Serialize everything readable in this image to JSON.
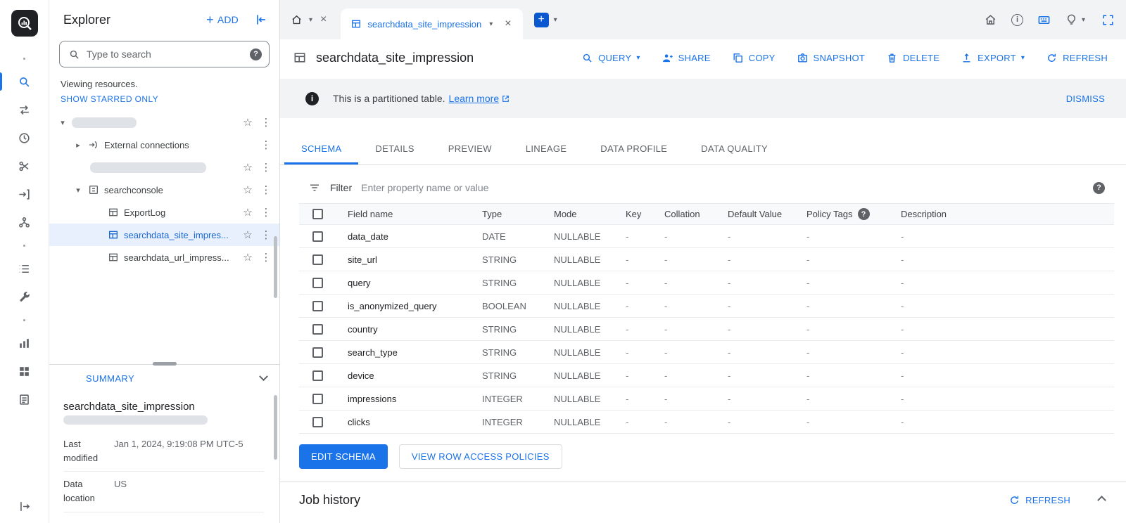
{
  "colors": {
    "accent": "#1a73e8",
    "selected_row_bg": "#e8f0fe",
    "strip_bg": "#f1f3f4"
  },
  "icons": {
    "star": "☆",
    "kebab": "⋮",
    "caret_down": "▾",
    "caret_right": "▸",
    "close": "×",
    "plus": "+",
    "help": "?",
    "info": "i"
  },
  "explorer": {
    "title": "Explorer",
    "add_label": "ADD",
    "search_placeholder": "Type to search",
    "viewing_text": "Viewing resources.",
    "show_starred_label": "SHOW STARRED ONLY",
    "tree": {
      "external_connections": "External connections",
      "dataset_searchconsole": "searchconsole",
      "table_exportlog": "ExportLog",
      "table_site_impression": "searchdata_site_impres...",
      "table_url_impression": "searchdata_url_impress..."
    },
    "summary": {
      "header": "SUMMARY",
      "table_name": "searchdata_site_impression",
      "rows": [
        {
          "label": "Last modified",
          "value": "Jan 1, 2024, 9:19:08 PM UTC-5"
        },
        {
          "label": "Data location",
          "value": "US"
        }
      ]
    }
  },
  "tabstrip": {
    "active_tab_label": "searchdata_site_impression"
  },
  "main": {
    "title": "searchdata_site_impression",
    "actions": {
      "query": "QUERY",
      "share": "SHARE",
      "copy": "COPY",
      "snapshot": "SNAPSHOT",
      "delete": "DELETE",
      "export": "EXPORT",
      "refresh": "REFRESH"
    },
    "banner": {
      "message": "This is a partitioned table.",
      "link_label": "Learn more",
      "dismiss_label": "DISMISS"
    },
    "tabs": [
      "SCHEMA",
      "DETAILS",
      "PREVIEW",
      "LINEAGE",
      "DATA PROFILE",
      "DATA QUALITY"
    ],
    "filter": {
      "label": "Filter",
      "placeholder": "Enter property name or value"
    },
    "schema": {
      "columns": [
        "Field name",
        "Type",
        "Mode",
        "Key",
        "Collation",
        "Default Value",
        "Policy Tags",
        "Description"
      ],
      "rows": [
        {
          "name": "data_date",
          "type": "DATE",
          "mode": "NULLABLE",
          "key": "-",
          "collation": "-",
          "default": "-",
          "policy": "-",
          "description": "-"
        },
        {
          "name": "site_url",
          "type": "STRING",
          "mode": "NULLABLE",
          "key": "-",
          "collation": "-",
          "default": "-",
          "policy": "-",
          "description": "-"
        },
        {
          "name": "query",
          "type": "STRING",
          "mode": "NULLABLE",
          "key": "-",
          "collation": "-",
          "default": "-",
          "policy": "-",
          "description": "-"
        },
        {
          "name": "is_anonymized_query",
          "type": "BOOLEAN",
          "mode": "NULLABLE",
          "key": "-",
          "collation": "-",
          "default": "-",
          "policy": "-",
          "description": "-"
        },
        {
          "name": "country",
          "type": "STRING",
          "mode": "NULLABLE",
          "key": "-",
          "collation": "-",
          "default": "-",
          "policy": "-",
          "description": "-"
        },
        {
          "name": "search_type",
          "type": "STRING",
          "mode": "NULLABLE",
          "key": "-",
          "collation": "-",
          "default": "-",
          "policy": "-",
          "description": "-"
        },
        {
          "name": "device",
          "type": "STRING",
          "mode": "NULLABLE",
          "key": "-",
          "collation": "-",
          "default": "-",
          "policy": "-",
          "description": "-"
        },
        {
          "name": "impressions",
          "type": "INTEGER",
          "mode": "NULLABLE",
          "key": "-",
          "collation": "-",
          "default": "-",
          "policy": "-",
          "description": "-"
        },
        {
          "name": "clicks",
          "type": "INTEGER",
          "mode": "NULLABLE",
          "key": "-",
          "collation": "-",
          "default": "-",
          "policy": "-",
          "description": "-"
        }
      ]
    },
    "edit_schema_label": "EDIT SCHEMA",
    "view_policies_label": "VIEW ROW ACCESS POLICIES",
    "job_history": {
      "title": "Job history",
      "refresh_label": "REFRESH"
    }
  }
}
